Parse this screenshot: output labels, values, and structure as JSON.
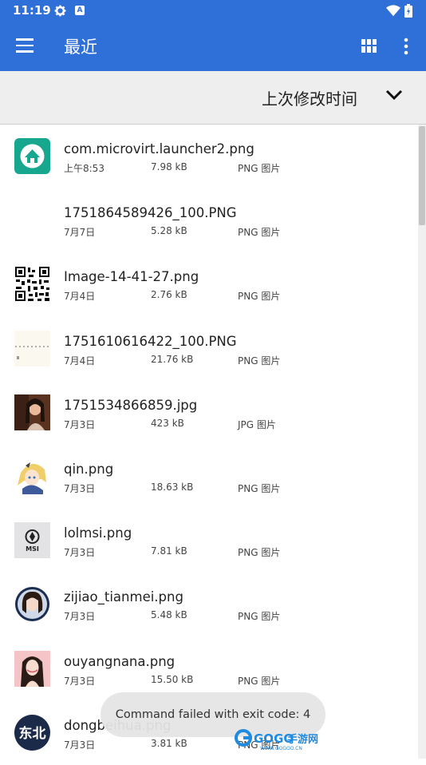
{
  "status": {
    "time": "11:19",
    "notif_letter": "A"
  },
  "app_bar": {
    "title": "最近"
  },
  "sort": {
    "label": "上次修改时间"
  },
  "files": [
    {
      "name": "com.microvirt.launcher2.png",
      "date": "上午8:53",
      "size": "7.98 kB",
      "type": "PNG 图片",
      "thumb": "launcher-icon"
    },
    {
      "name": "1751864589426_100.PNG",
      "date": "7月7日",
      "size": "5.28 kB",
      "type": "PNG 图片",
      "thumb": "blank-thumbnail"
    },
    {
      "name": "Image-14-41-27.png",
      "date": "7月4日",
      "size": "2.76 kB",
      "type": "PNG 图片",
      "thumb": "qr-code-thumbnail"
    },
    {
      "name": "1751610616422_100.PNG",
      "date": "7月4日",
      "size": "21.76 kB",
      "type": "PNG 图片",
      "thumb": "text-image-thumbnail"
    },
    {
      "name": "1751534866859.jpg",
      "date": "7月3日",
      "size": "423 kB",
      "type": "JPG 图片",
      "thumb": "photo-thumbnail"
    },
    {
      "name": "qin.png",
      "date": "7月3日",
      "size": "18.63 kB",
      "type": "PNG 图片",
      "thumb": "anime-character-thumbnail"
    },
    {
      "name": "lolmsi.png",
      "date": "7月3日",
      "size": "7.81 kB",
      "type": "PNG 图片",
      "thumb": "msi-logo-thumbnail",
      "logo_text": "MSI"
    },
    {
      "name": "zijiao_tianmei.png",
      "date": "7月3日",
      "size": "5.48 kB",
      "type": "PNG 图片",
      "thumb": "portrait-thumbnail"
    },
    {
      "name": "ouyangnana.png",
      "date": "7月3日",
      "size": "15.50 kB",
      "type": "PNG 图片",
      "thumb": "portrait-thumbnail"
    },
    {
      "name": "dongbeihua.png",
      "date": "7月3日",
      "size": "3.81 kB",
      "type": "PNG 图片",
      "thumb": "dongbei-text-thumbnail",
      "logo_text": "东北"
    }
  ],
  "toast": {
    "message": "Command failed with exit code: 4"
  },
  "watermark": {
    "text": "GOGO手游网",
    "subtext": "WWW.GOGOO.CN"
  },
  "colors": {
    "primary": "#2f6fd8",
    "sort_bar": "#eeeeee",
    "launcher_icon": "#17a78f"
  }
}
